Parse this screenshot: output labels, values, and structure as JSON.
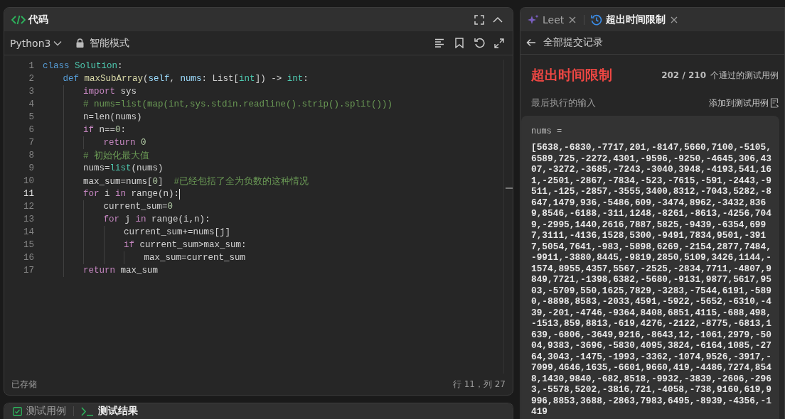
{
  "code_panel": {
    "title": "代码",
    "language": "Python3",
    "mode": "智能模式",
    "lines": [
      {
        "number": "1",
        "current": false,
        "tokens": [
          {
            "kind": "keyword",
            "text": "class "
          },
          {
            "kind": "type",
            "text": "Solution"
          },
          {
            "kind": "plain",
            "text": ":"
          }
        ]
      },
      {
        "number": "2",
        "current": false,
        "tokens": [
          {
            "kind": "keyword",
            "text": "    def "
          },
          {
            "kind": "function",
            "text": "maxSubArray"
          },
          {
            "kind": "plain",
            "text": "("
          },
          {
            "kind": "param",
            "text": "self"
          },
          {
            "kind": "plain",
            "text": ", "
          },
          {
            "kind": "param",
            "text": "nums"
          },
          {
            "kind": "plain",
            "text": ": List["
          },
          {
            "kind": "type",
            "text": "int"
          },
          {
            "kind": "plain",
            "text": "]) -> "
          },
          {
            "kind": "type",
            "text": "int"
          },
          {
            "kind": "plain",
            "text": ":"
          }
        ]
      },
      {
        "number": "3",
        "current": false,
        "tokens": [
          {
            "kind": "control",
            "text": "        import"
          },
          {
            "kind": "plain",
            "text": " sys"
          }
        ]
      },
      {
        "number": "4",
        "current": false,
        "tokens": [
          {
            "kind": "comment",
            "text": "        # nums=list(map(int,sys.stdin.readline().strip().split()))"
          }
        ]
      },
      {
        "number": "5",
        "current": false,
        "tokens": [
          {
            "kind": "plain",
            "text": "        n=len(nums)"
          }
        ]
      },
      {
        "number": "6",
        "current": false,
        "tokens": [
          {
            "kind": "control",
            "text": "        if"
          },
          {
            "kind": "plain",
            "text": " n=="
          },
          {
            "kind": "number",
            "text": "0"
          },
          {
            "kind": "plain",
            "text": ":"
          }
        ]
      },
      {
        "number": "7",
        "current": false,
        "tokens": [
          {
            "kind": "control",
            "text": "            return "
          },
          {
            "kind": "number",
            "text": "0"
          }
        ]
      },
      {
        "number": "8",
        "current": false,
        "tokens": [
          {
            "kind": "comment",
            "text": "        # 初始化最大值"
          }
        ]
      },
      {
        "number": "9",
        "current": false,
        "tokens": [
          {
            "kind": "plain",
            "text": "        nums="
          },
          {
            "kind": "type",
            "text": "list"
          },
          {
            "kind": "plain",
            "text": "(nums)"
          }
        ]
      },
      {
        "number": "10",
        "current": false,
        "tokens": [
          {
            "kind": "plain",
            "text": "        max_sum=nums["
          },
          {
            "kind": "number",
            "text": "0"
          },
          {
            "kind": "plain",
            "text": "]  "
          },
          {
            "kind": "comment",
            "text": "#已经包括了全为负数的这种情况"
          }
        ]
      },
      {
        "number": "11",
        "current": true,
        "tokens": [
          {
            "kind": "control",
            "text": "        for"
          },
          {
            "kind": "plain",
            "text": " i "
          },
          {
            "kind": "control",
            "text": "in"
          },
          {
            "kind": "plain",
            "text": " range(n):"
          }
        ]
      },
      {
        "number": "12",
        "current": false,
        "tokens": [
          {
            "kind": "plain",
            "text": "            current_sum="
          },
          {
            "kind": "number",
            "text": "0"
          }
        ]
      },
      {
        "number": "13",
        "current": false,
        "tokens": [
          {
            "kind": "control",
            "text": "            for"
          },
          {
            "kind": "plain",
            "text": " j "
          },
          {
            "kind": "control",
            "text": "in"
          },
          {
            "kind": "plain",
            "text": " range(i,n):"
          }
        ]
      },
      {
        "number": "14",
        "current": false,
        "tokens": [
          {
            "kind": "plain",
            "text": "                current_sum+=nums[j]"
          }
        ]
      },
      {
        "number": "15",
        "current": false,
        "tokens": [
          {
            "kind": "control",
            "text": "                if"
          },
          {
            "kind": "plain",
            "text": " current_sum>max_sum:"
          }
        ]
      },
      {
        "number": "16",
        "current": false,
        "tokens": [
          {
            "kind": "plain",
            "text": "                    max_sum=current_sum"
          }
        ]
      },
      {
        "number": "17",
        "current": false,
        "tokens": [
          {
            "kind": "control",
            "text": "        return"
          },
          {
            "kind": "plain",
            "text": " max_sum"
          }
        ]
      }
    ],
    "status": "已存储",
    "cursor_position": "行 11，列 27"
  },
  "bottom_tabs": [
    {
      "label": "测试用例",
      "selected": false
    },
    {
      "label": "测试结果",
      "selected": true
    }
  ],
  "result_panel": {
    "tabs": [
      {
        "label": "Leet",
        "selected": false
      },
      {
        "label": "超出时间限制",
        "selected": true
      }
    ],
    "back_link": "全部提交记录",
    "verdict": "超出时间限制",
    "passed": "202 / 210",
    "passed_label": "个通过的测试用例",
    "input_heading": "最后执行的输入",
    "add_to_tests": "添加到测试用例",
    "input_name": "nums =",
    "input_value": "[5638,-6830,-7717,201,-8147,5660,7100,-5105,6589,725,-2272,4301,-9596,-9250,-4645,306,4307,-3272,-3685,-7243,-3040,3948,-4193,541,161,-2501,-2867,-7834,-523,-7615,-591,-2443,-9511,-125,-2857,-3555,3400,8312,-7043,5282,-8647,1479,936,-5486,609,-3474,8962,-3432,8369,8546,-6188,-311,1248,-8261,-8613,-4256,7049,-2995,1440,2616,7887,5825,-9439,-6354,6997,3111,-4136,1528,5300,-9491,7834,9501,-3917,5054,7641,-983,-5898,6269,-2154,2877,7484,-9911,-3880,8445,-9819,2850,5109,3426,1144,-1574,8955,4357,5567,-2525,-2834,7711,-4807,9849,7721,-1398,6382,-5680,-9131,9877,5617,9503,-5709,550,1625,7829,-3283,-7544,6191,-5890,-8898,8583,-2033,4591,-5922,-5652,-6310,-439,-201,-4746,-9364,8408,6851,4115,-688,498,-1513,859,8813,-619,4276,-2122,-8775,-6813,1639,-6806,-3649,9216,-8643,12,-1061,2979,-5004,9383,-3696,-5830,4095,3824,-6164,1085,-2764,3043,-1475,-1993,-3362,-1074,9526,-3917,-7099,4646,1635,-6601,9660,419,-4486,7274,8548,1430,9840,-682,8518,-9932,-3839,-2606,-2963,-5578,5202,-3816,721,-4058,-738,9160,619,9996,8853,3688,-2863,7983,6495,-8939,-4356,-1419"
  }
}
